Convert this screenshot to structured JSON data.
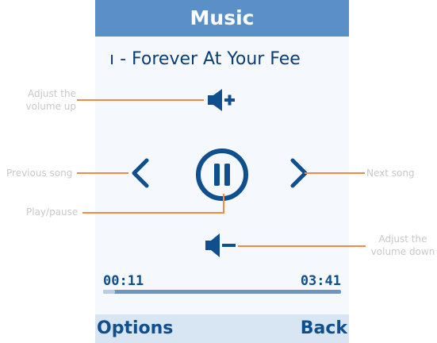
{
  "app": {
    "title": "Music"
  },
  "now_playing": {
    "track_text": "ı - Forever At Your Fee"
  },
  "playback": {
    "elapsed": "00:11",
    "total": "03:41",
    "progress_fraction": 0.05
  },
  "softkeys": {
    "left": "Options",
    "right": "Back"
  },
  "callouts": {
    "volume_up": "Adjust the volume up",
    "previous": "Previous song",
    "play_pause": "Play/pause",
    "next": "Next song",
    "volume_down": "Adjust the volume down"
  },
  "colors": {
    "accent": "#0f4f8d",
    "titlebar": "#5a8fc7",
    "callout": "#f08a45"
  },
  "icons": [
    "volume-up-icon",
    "previous-icon",
    "pause-icon",
    "next-icon",
    "volume-down-icon"
  ]
}
